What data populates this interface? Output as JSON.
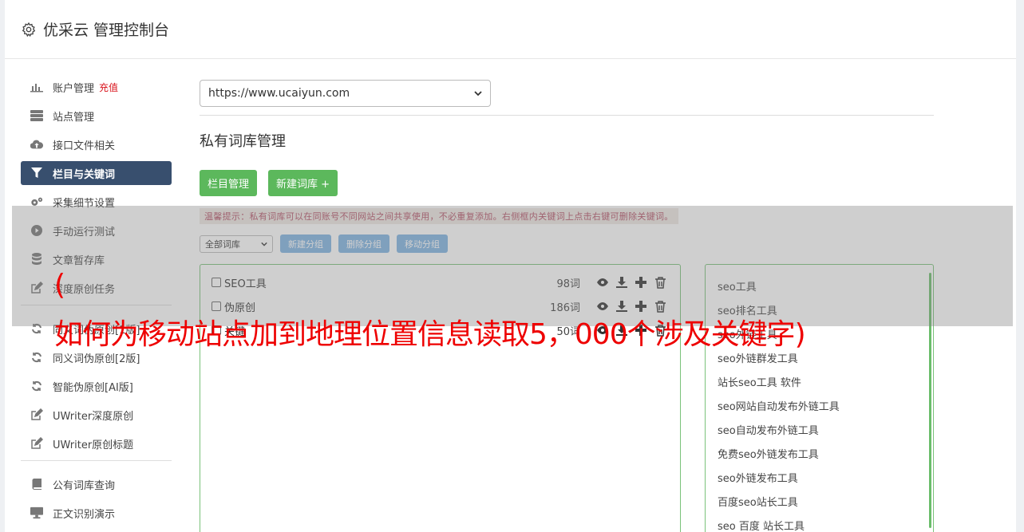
{
  "header": {
    "title": "优采云 管理控制台"
  },
  "sidebar": {
    "items": [
      {
        "label": "账户管理",
        "badge": "充值",
        "icon": "bar-chart-icon"
      },
      {
        "label": "站点管理",
        "icon": "server-icon"
      },
      {
        "label": "接口文件相关",
        "icon": "cloud-upload-icon"
      },
      {
        "label": "栏目与关键词",
        "icon": "filter-icon",
        "active": true
      },
      {
        "label": "采集细节设置",
        "icon": "cogs-icon"
      },
      {
        "label": "手动运行测试",
        "icon": "play-circle-icon"
      },
      {
        "label": "文章暂存库",
        "icon": "database-icon"
      },
      {
        "label": "深度原创任务",
        "icon": "edit-icon"
      },
      {
        "label": "同义词伪原创[1版]",
        "icon": "refresh-icon"
      },
      {
        "label": "同义词伪原创[2版]",
        "icon": "refresh-icon"
      },
      {
        "label": "智能伪原创[AI版]",
        "icon": "refresh-icon"
      },
      {
        "label": "UWriter深度原创",
        "icon": "edit-icon"
      },
      {
        "label": "UWriter原创标题",
        "icon": "edit-icon"
      },
      {
        "label": "公有词库查询",
        "icon": "book-icon"
      },
      {
        "label": "正文识别演示",
        "icon": "monitor-icon"
      }
    ]
  },
  "main": {
    "site_select": "https://www.ucaiyun.com",
    "section_title": "私有词库管理",
    "buttons": {
      "column_manage": "栏目管理",
      "new_lexicon": "新建词库 +"
    },
    "tip": "温馨提示：私有词库可以在同账号不同网站之间共享使用，不必重复添加。右侧框内关键词上点击右键可删除关键词。",
    "toolbar": {
      "filter_select": "全部词库",
      "new_group": "新建分组",
      "delete_group": "删除分组",
      "move_group": "移动分组"
    },
    "lexicons": [
      {
        "name": "SEO工具",
        "count": "98词"
      },
      {
        "name": "伪原创",
        "count": "186词"
      },
      {
        "name": "关键",
        "count": "50词"
      }
    ],
    "keywords": [
      "seo工具",
      "seo排名工具",
      "seo外链工具",
      "seo外链群发工具",
      "站长seo工具 软件",
      "seo网站自动发布外链工具",
      "seo自动发布外链工具",
      "免费seo外链发布工具",
      "seo外链发布工具",
      "百度seo站长工具",
      "seo 百度 站长工具"
    ]
  },
  "overlay": {
    "caption_line1": "(",
    "caption_line2": "如何为移动站点加到地理位置信息读取5，000个涉及关键字)"
  },
  "colors": {
    "active_nav": "#384f6e",
    "green_button": "#5cb85c",
    "blue_button": "#7fb3e3",
    "caption": "#ee0000",
    "recharge": "#d9141c"
  }
}
